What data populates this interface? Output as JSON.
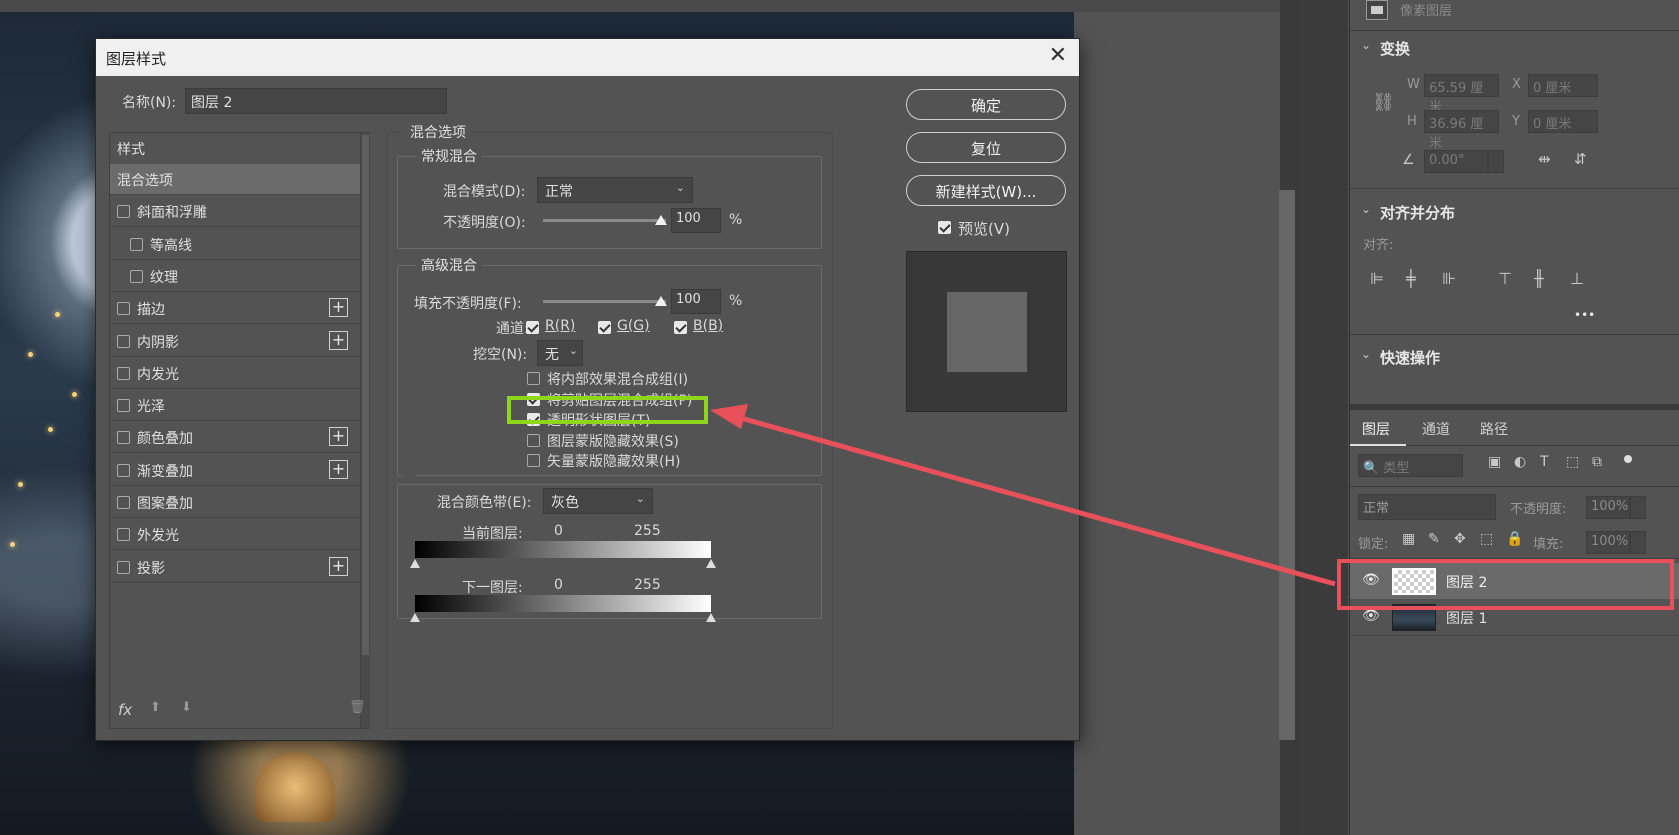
{
  "dialog": {
    "title": "图层样式",
    "close_glyph": "✕",
    "name_label": "名称(N):",
    "name_value": "图层 2",
    "styles_header": "样式",
    "style_items": [
      {
        "label": "混合选项",
        "checkbox": false,
        "selected": true,
        "plus": false,
        "indent": false
      },
      {
        "label": "斜面和浮雕",
        "checkbox": true,
        "checked": false,
        "plus": false,
        "indent": false
      },
      {
        "label": "等高线",
        "checkbox": true,
        "checked": false,
        "plus": false,
        "indent": true
      },
      {
        "label": "纹理",
        "checkbox": true,
        "checked": false,
        "plus": false,
        "indent": true
      },
      {
        "label": "描边",
        "checkbox": true,
        "checked": false,
        "plus": true,
        "indent": false
      },
      {
        "label": "内阴影",
        "checkbox": true,
        "checked": false,
        "plus": true,
        "indent": false
      },
      {
        "label": "内发光",
        "checkbox": true,
        "checked": false,
        "plus": false,
        "indent": false
      },
      {
        "label": "光泽",
        "checkbox": true,
        "checked": false,
        "plus": false,
        "indent": false
      },
      {
        "label": "颜色叠加",
        "checkbox": true,
        "checked": false,
        "plus": true,
        "indent": false
      },
      {
        "label": "渐变叠加",
        "checkbox": true,
        "checked": false,
        "plus": true,
        "indent": false
      },
      {
        "label": "图案叠加",
        "checkbox": true,
        "checked": false,
        "plus": false,
        "indent": false
      },
      {
        "label": "外发光",
        "checkbox": true,
        "checked": false,
        "plus": false,
        "indent": false
      },
      {
        "label": "投影",
        "checkbox": true,
        "checked": false,
        "plus": true,
        "indent": false
      }
    ],
    "footer": {
      "fx": "fx",
      "up": "⬆",
      "down": "⬇",
      "trash": "🗑"
    },
    "blend_options_title": "混合选项",
    "general_blend": {
      "title": "常规混合",
      "mode_label": "混合模式(D):",
      "mode_value": "正常",
      "opacity_label": "不透明度(O):",
      "opacity_value": "100",
      "percent": "%"
    },
    "advanced_blend": {
      "title": "高级混合",
      "fill_label": "填充不透明度(F):",
      "fill_value": "100",
      "percent": "%",
      "channels_label": "通道:",
      "channels": [
        {
          "label": "R(R)",
          "checked": true
        },
        {
          "label": "G(G)",
          "checked": true
        },
        {
          "label": "B(B)",
          "checked": true
        }
      ],
      "knockout_label": "挖空(N):",
      "knockout_value": "无",
      "options": [
        {
          "label": "将内部效果混合成组(I)",
          "checked": false
        },
        {
          "label": "将剪贴图层混合成组(P)",
          "checked": true
        },
        {
          "label": "透明形状图层(T)",
          "checked": true
        },
        {
          "label": "图层蒙版隐藏效果(S)",
          "checked": false
        },
        {
          "label": "矢量蒙版隐藏效果(H)",
          "checked": false
        }
      ]
    },
    "blend_if": {
      "label": "混合颜色带(E):",
      "value": "灰色",
      "current_label": "当前图层:",
      "current_min": "0",
      "current_max": "255",
      "under_label": "下一图层:",
      "under_min": "0",
      "under_max": "255"
    },
    "buttons": {
      "ok": "确定",
      "reset": "复位",
      "new_style": "新建样式(W)..."
    },
    "preview_label": "预览(V)",
    "preview_checked": true
  },
  "panel": {
    "pixel_layer_label": "像素图层",
    "transform": {
      "title": "变换",
      "w_label": "W",
      "w_value": "65.59 厘米",
      "h_label": "H",
      "h_value": "36.96 厘米",
      "x_label": "X",
      "x_value": "0 厘米",
      "y_label": "Y",
      "y_value": "0 厘米",
      "angle_value": "0.00°"
    },
    "align": {
      "title": "对齐并分布",
      "align_label": "对齐:",
      "more": "•••"
    },
    "quick": {
      "title": "快速操作"
    },
    "layers": {
      "tabs": [
        "图层",
        "通道",
        "路径"
      ],
      "filter_placeholder": "类型",
      "blend_mode": "正常",
      "opacity_label": "不透明度:",
      "opacity_value": "100%",
      "lock_label": "锁定:",
      "fill_label": "填充:",
      "fill_value": "100%",
      "items": [
        {
          "name": "图层 2",
          "selected": true
        },
        {
          "name": "图层 1",
          "selected": false
        }
      ]
    }
  },
  "colors": {
    "highlight_green": "#8fd61a",
    "annotation_red": "#e8505a"
  }
}
